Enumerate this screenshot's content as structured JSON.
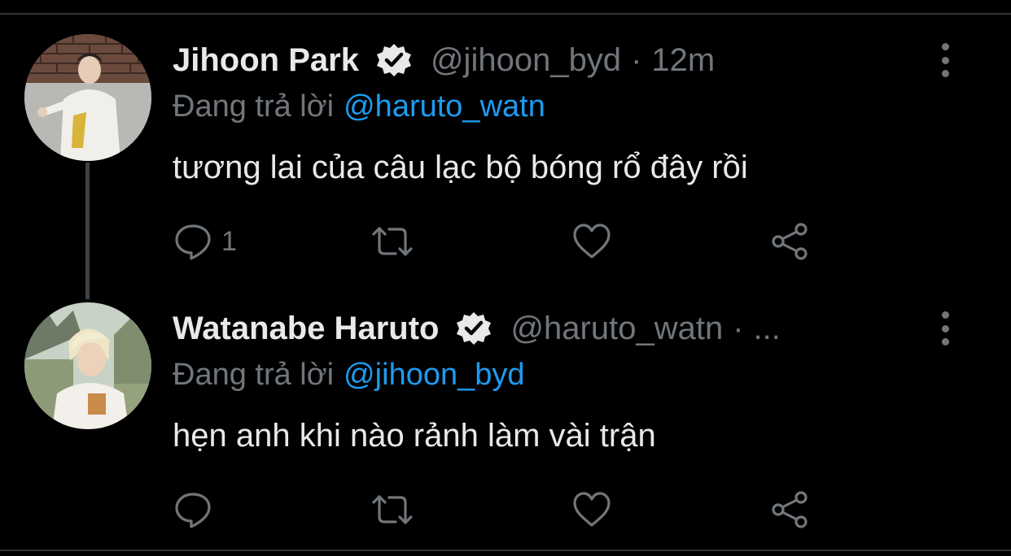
{
  "thread": [
    {
      "name": "Jihoon Park",
      "verified": true,
      "handle": "@jihoon_byd",
      "separator": "·",
      "time": "12m",
      "reply_label": "Đang trả lời",
      "reply_handle": "@haruto_watn",
      "text": "tương lai của câu lạc bộ bóng rổ đây rồi",
      "reply_count": "1",
      "avatar_icon": "profile-photo"
    },
    {
      "name": "Watanabe Haruto",
      "verified": true,
      "handle": "@haruto_watn",
      "separator": "·",
      "time": "...",
      "reply_label": "Đang trả lời",
      "reply_handle": "@jihoon_byd",
      "text": "hẹn anh khi nào rảnh làm vài trận",
      "reply_count": "",
      "avatar_icon": "profile-photo"
    }
  ],
  "colors": {
    "background": "#000000",
    "text": "#e7e9ea",
    "muted": "#71767b",
    "link": "#1d9bf0",
    "thread_line": "#3d4248"
  },
  "icons": [
    "reply-icon",
    "retweet-icon",
    "like-icon",
    "share-icon",
    "more-icon",
    "verified-badge-icon"
  ]
}
